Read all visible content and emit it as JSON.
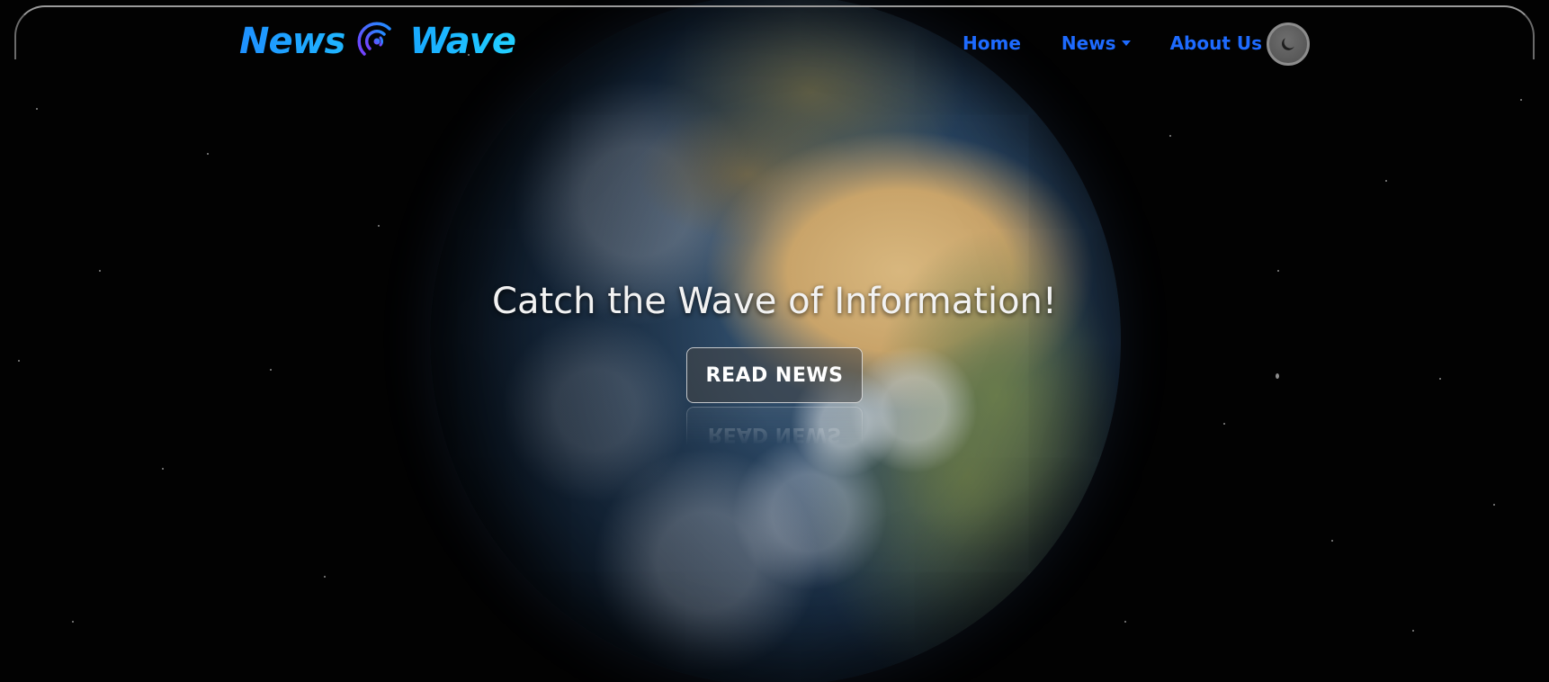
{
  "brand": {
    "word1": "News",
    "word2": "Wave",
    "icon": "broadcast-signal-icon"
  },
  "nav": {
    "items": [
      {
        "label": "Home"
      },
      {
        "label": "News",
        "has_dropdown": true
      },
      {
        "label": "About Us"
      }
    ],
    "theme_toggle_icon": "moon-icon"
  },
  "hero": {
    "title": "Catch the Wave of Information!",
    "button_label": "READ NEWS"
  },
  "colors": {
    "nav_link": "#1e6bff",
    "brand_gradient_start": "#1e90ff",
    "brand_gradient_end": "#22d0ff",
    "background": "#020202"
  }
}
